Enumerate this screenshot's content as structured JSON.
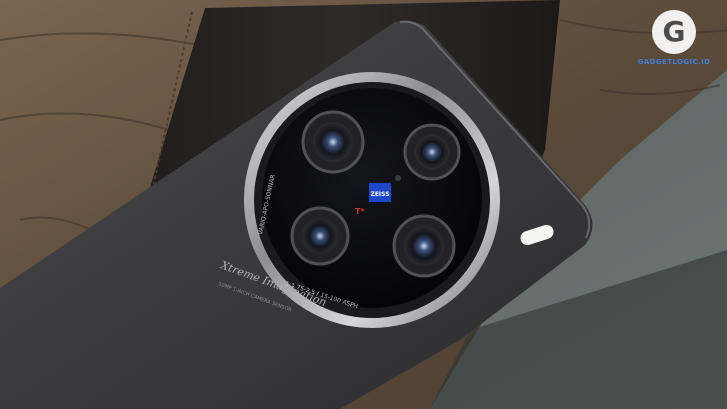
{
  "watermark": {
    "badge_letter": "G",
    "site_text": "GADGETLOGIC.ID"
  },
  "lens_module": {
    "brand_badge_text": "ZEISS",
    "badge_marking": "T*",
    "spec_text": "1:1.75-2.5 / 15-100 ASPH",
    "vario_text": "VARIO-APO-SONNAR"
  },
  "phone_back": {
    "signature_text": "Xtreme Imagination",
    "signature_subtext": "50MP 1-INCH CAMERA SENSOR"
  },
  "colors": {
    "phone_body": "#3b3b3d",
    "lens_glass": "#0b0c10",
    "ring_chrome": "#c7c7cb",
    "zeiss_blue": "#1d46c8",
    "table_wood": "#6e5a45",
    "case_leather": "#262322",
    "background_wall": "#5d6663"
  }
}
